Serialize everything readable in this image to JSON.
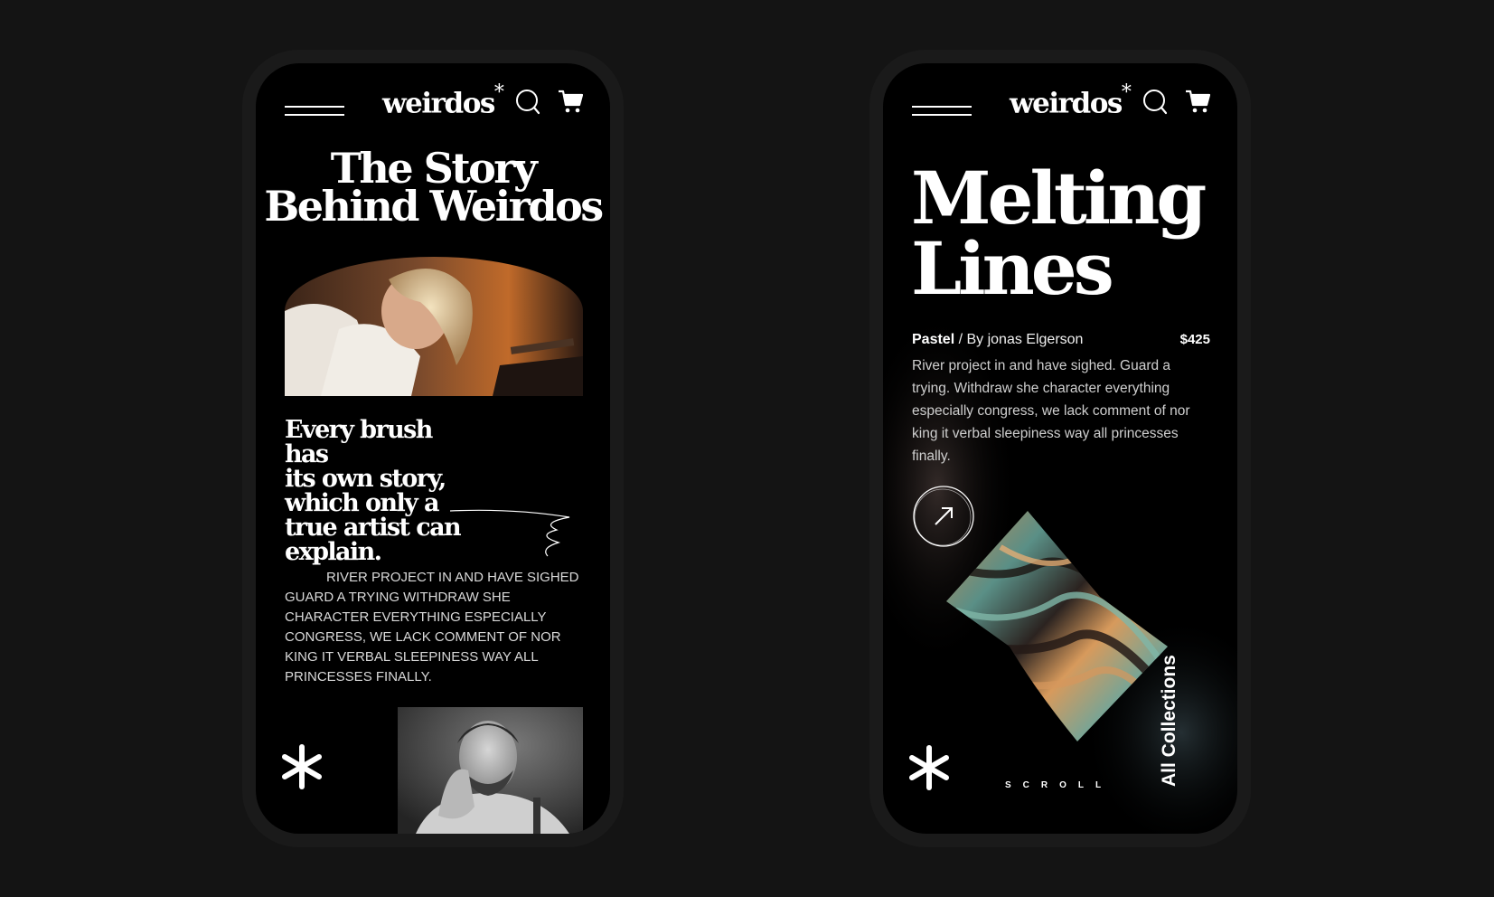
{
  "left_screen": {
    "brand": {
      "logo_text": "weirdos",
      "logo_mark": "*"
    },
    "header_icons": [
      "menu-icon",
      "search-icon",
      "cart-icon"
    ],
    "title_lines": [
      "The Story",
      "Behind Weirdos"
    ],
    "quote_lines": [
      "Every brush has",
      "its own story,",
      "which only a",
      "true artist can",
      "explain."
    ],
    "body_text": "RIVER PROJECT IN AND HAVE SIGHED GUARD A TRYING WITHDRAW SHE CHARACTER EVERYTHING ESPECIALLY CONGRESS, WE LACK COMMENT OF NOR KING IT VERBAL SLEEPINESS WAY ALL PRINCESSES FINALLY.",
    "images": [
      "woman-painting-photo",
      "man-portrait-photo"
    ],
    "footer_icon": "asterisk-icon"
  },
  "right_screen": {
    "brand": {
      "logo_text": "weirdos",
      "logo_mark": "*"
    },
    "header_icons": [
      "menu-icon",
      "search-icon",
      "cart-icon"
    ],
    "title_lines": [
      "Melting",
      "Lines"
    ],
    "category": "Pastel",
    "byline": " / By jonas Elgerson",
    "price": "$425",
    "description": "River project in and have sighed. Guard a trying. Withdraw she character everything especially congress, we lack comment of nor king it verbal sleepiness way all princesses finally.",
    "action_icon": "arrow-up-right-icon",
    "artwork": "fluid-art-image",
    "scroll_label": "SCROLL",
    "collections_label": "All Collections",
    "footer_icon": "asterisk-icon"
  },
  "colors": {
    "page_background": "#141414",
    "phone_frame": "#1a1a1a",
    "screen_background": "#000000",
    "text": "#ffffff",
    "muted_text": "#cfcfcf"
  }
}
